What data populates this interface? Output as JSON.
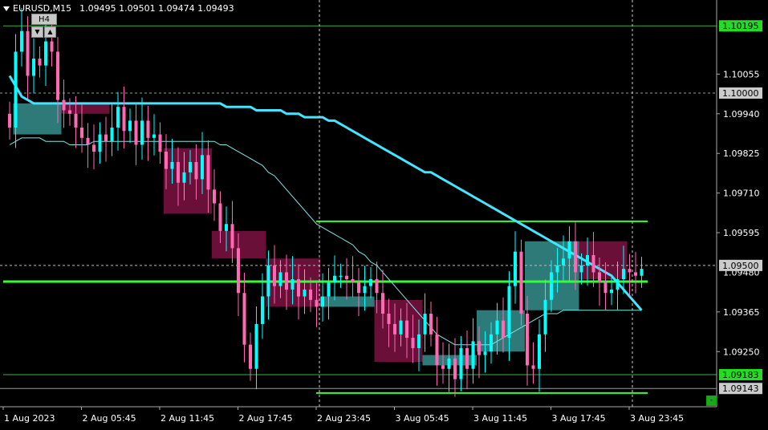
{
  "header": {
    "symbol_tf": "EURUSD,M15",
    "ohlc": "1.09495 1.09501 1.09474 1.09493",
    "menu_icon": "triangle-down-icon"
  },
  "controls": {
    "timeframe_label": "H4",
    "down_icon": "arrow-down-icon",
    "up_icon": "arrow-up-icon",
    "corner_label": "-"
  },
  "colors": {
    "background": "#000000",
    "bull_candle": "#00ffff",
    "bear_candle": "#ff69b4",
    "bull_box": "#2d7a78",
    "bear_box": "#6a0f38",
    "level_line": "#33ff33",
    "ma_slow": "#44e6ff",
    "ma_mid": "#7fe8e8",
    "price_tag_green": "#22dd22",
    "price_tag_gray": "#cccccc"
  },
  "chart_data": {
    "type": "candlestick",
    "ylim": [
      1.0909,
      1.1027
    ],
    "x_ticks": [
      {
        "i": 0,
        "label": "1 Aug 2023"
      },
      {
        "i": 13,
        "label": "2 Aug 05:45"
      },
      {
        "i": 26,
        "label": "2 Aug 11:45"
      },
      {
        "i": 39,
        "label": "2 Aug 17:45"
      },
      {
        "i": 52,
        "label": "2 Aug 23:45"
      },
      {
        "i": 65,
        "label": "3 Aug 05:45"
      },
      {
        "i": 78,
        "label": "3 Aug 11:45"
      },
      {
        "i": 91,
        "label": "3 Aug 17:45"
      },
      {
        "i": 104,
        "label": "3 Aug 23:45"
      }
    ],
    "y_ticks": [
      "1.10055",
      "1.09940",
      "1.09825",
      "1.09710",
      "1.09595",
      "1.09365",
      "1.09250"
    ],
    "y_tick_values": [
      1.10055,
      1.0994,
      1.09825,
      1.0971,
      1.09595,
      1.09365,
      1.0925
    ],
    "price_tags": [
      {
        "label": "1.10195",
        "value": 1.10195,
        "style": "green"
      },
      {
        "label": "1.10000",
        "value": 1.1,
        "style": "gray"
      },
      {
        "label": "1.09500",
        "value": 1.095,
        "style": "gray"
      },
      {
        "label": "1.09183",
        "value": 1.09183,
        "style": "green"
      },
      {
        "label": "1.09143",
        "value": 1.09143,
        "style": "gray"
      }
    ],
    "partial_tick_label": "1.09480",
    "vertical_markers": [
      52,
      104
    ],
    "levels": [
      {
        "value": 1.09453,
        "i_start": 0,
        "i_end": 106,
        "style": "thick"
      },
      {
        "value": 1.09628,
        "i_start": 52,
        "i_end": 106,
        "style": "normal"
      },
      {
        "value": 1.0913,
        "i_start": 52,
        "i_end": 106,
        "style": "normal"
      },
      {
        "value": 1.10195,
        "i_start": 0,
        "i_end": 120,
        "style": "thin"
      },
      {
        "value": 1.09183,
        "i_start": 0,
        "i_end": 120,
        "style": "thin"
      }
    ],
    "boxes": [
      {
        "i0": 1,
        "i1": 9,
        "top": 1.0997,
        "bottom": 1.0988,
        "kind": "bull"
      },
      {
        "i0": 9,
        "i1": 17,
        "top": 1.0997,
        "bottom": 1.0994,
        "kind": "bear"
      },
      {
        "i0": 26,
        "i1": 34,
        "top": 1.0984,
        "bottom": 1.0965,
        "kind": "bear"
      },
      {
        "i0": 34,
        "i1": 43,
        "top": 1.096,
        "bottom": 1.0952,
        "kind": "bear"
      },
      {
        "i0": 43,
        "i1": 52,
        "top": 1.0952,
        "bottom": 1.0938,
        "kind": "bear"
      },
      {
        "i0": 52,
        "i1": 61,
        "top": 1.0941,
        "bottom": 1.0938,
        "kind": "bull"
      },
      {
        "i0": 61,
        "i1": 69,
        "top": 1.094,
        "bottom": 1.0922,
        "kind": "bear"
      },
      {
        "i0": 69,
        "i1": 78,
        "top": 1.0924,
        "bottom": 1.0921,
        "kind": "bull"
      },
      {
        "i0": 78,
        "i1": 86,
        "top": 1.0937,
        "bottom": 1.0925,
        "kind": "bull"
      },
      {
        "i0": 86,
        "i1": 95,
        "top": 1.0957,
        "bottom": 1.0937,
        "kind": "bull"
      },
      {
        "i0": 95,
        "i1": 103,
        "top": 1.0957,
        "bottom": 1.0946,
        "kind": "bear"
      }
    ],
    "closes": [
      1.099,
      1.1012,
      1.1018,
      1.1005,
      1.101,
      1.1008,
      1.1015,
      1.1012,
      1.0998,
      1.0995,
      1.0994,
      1.099,
      1.0987,
      1.0985,
      1.0983,
      1.0988,
      1.0986,
      1.099,
      1.0996,
      1.0989,
      1.0992,
      1.0985,
      1.0992,
      1.0987,
      1.0988,
      1.0983,
      1.0978,
      1.098,
      1.0974,
      1.0977,
      1.098,
      1.0975,
      1.0982,
      1.0972,
      1.0968,
      1.096,
      1.0962,
      1.0955,
      1.0942,
      1.0927,
      1.092,
      1.0933,
      1.0941,
      1.095,
      1.0944,
      1.0948,
      1.0943,
      1.0946,
      1.0941,
      1.0943,
      1.094,
      1.0938,
      1.0941,
      1.0945,
      1.0947,
      1.0947,
      1.0946,
      1.0945,
      1.0942,
      1.0944,
      1.0946,
      1.0942,
      1.0936,
      1.0933,
      1.093,
      1.0934,
      1.0929,
      1.0926,
      1.093,
      1.0936,
      1.093,
      1.0921,
      1.092,
      1.0923,
      1.0917,
      1.0926,
      1.092,
      1.0928,
      1.0924,
      1.0925,
      1.093,
      1.0934,
      1.0929,
      1.0944,
      1.0954,
      1.0936,
      1.0921,
      1.092,
      1.093,
      1.094,
      1.0948,
      1.095,
      1.0952,
      1.0957,
      1.0948,
      1.095,
      1.0953,
      1.0948,
      1.0945,
      1.0942,
      1.0943,
      1.0946,
      1.0949,
      1.0948,
      1.0947,
      1.0949
    ],
    "ma_slow": [
      1.1005,
      1.1002,
      1.0999,
      1.0998,
      1.0997,
      1.0997,
      1.0997,
      1.0997,
      1.0997,
      1.0997,
      1.0997,
      1.0997,
      1.0997,
      1.0997,
      1.0997,
      1.0997,
      1.0997,
      1.0997,
      1.0997,
      1.0997,
      1.0997,
      1.0997,
      1.0997,
      1.0997,
      1.0997,
      1.0997,
      1.0997,
      1.0997,
      1.0997,
      1.0997,
      1.0997,
      1.0997,
      1.0997,
      1.0997,
      1.0997,
      1.0997,
      1.0996,
      1.0996,
      1.0996,
      1.0996,
      1.0996,
      1.0995,
      1.0995,
      1.0995,
      1.0995,
      1.0995,
      1.0994,
      1.0994,
      1.0994,
      1.0993,
      1.0993,
      1.0993,
      1.0993,
      1.0992,
      1.0992,
      1.0991,
      1.099,
      1.0989,
      1.0988,
      1.0987,
      1.0986,
      1.0985,
      1.0984,
      1.0983,
      1.0982,
      1.0981,
      1.098,
      1.0979,
      1.0978,
      1.0977,
      1.0977,
      1.0976,
      1.0975,
      1.0974,
      1.0973,
      1.0972,
      1.0971,
      1.097,
      1.0969,
      1.0968,
      1.0967,
      1.0966,
      1.0965,
      1.0964,
      1.0963,
      1.0962,
      1.0961,
      1.096,
      1.0959,
      1.0958,
      1.0957,
      1.0956,
      1.0955,
      1.0954,
      1.0953,
      1.0952,
      1.0951,
      1.095,
      1.0949,
      1.0948,
      1.0947,
      1.0945,
      1.0943,
      1.0941,
      1.0939,
      1.0937
    ],
    "ma_mid": [
      1.0985,
      1.0986,
      1.0987,
      1.0987,
      1.0987,
      1.0987,
      1.0986,
      1.0986,
      1.0986,
      1.0986,
      1.0985,
      1.0985,
      1.0985,
      1.0985,
      1.0986,
      1.0986,
      1.0986,
      1.0986,
      1.0986,
      1.0986,
      1.0986,
      1.0986,
      1.0986,
      1.0986,
      1.0986,
      1.0986,
      1.0986,
      1.0986,
      1.0986,
      1.0986,
      1.0986,
      1.0986,
      1.0986,
      1.0986,
      1.0986,
      1.0985,
      1.0985,
      1.0984,
      1.0983,
      1.0982,
      1.0981,
      1.098,
      1.0979,
      1.0977,
      1.0976,
      1.0974,
      1.0972,
      1.097,
      1.0968,
      1.0966,
      1.0964,
      1.0962,
      1.0961,
      1.096,
      1.0959,
      1.0958,
      1.0957,
      1.0956,
      1.0954,
      1.0953,
      1.0951,
      1.095,
      1.0948,
      1.0946,
      1.0944,
      1.0942,
      1.094,
      1.0938,
      1.0936,
      1.0934,
      1.0932,
      1.093,
      1.0929,
      1.0928,
      1.0927,
      1.0927,
      1.0927,
      1.0927,
      1.0927,
      1.0927,
      1.0927,
      1.0928,
      1.0929,
      1.093,
      1.0931,
      1.0932,
      1.0933,
      1.0934,
      1.0935,
      1.0936,
      1.0936,
      1.0936,
      1.0937,
      1.0937,
      1.0937,
      1.0937,
      1.0937,
      1.0937,
      1.0937,
      1.0937,
      1.0937,
      1.0937,
      1.0937,
      1.0937,
      1.0937,
      1.0937
    ]
  }
}
